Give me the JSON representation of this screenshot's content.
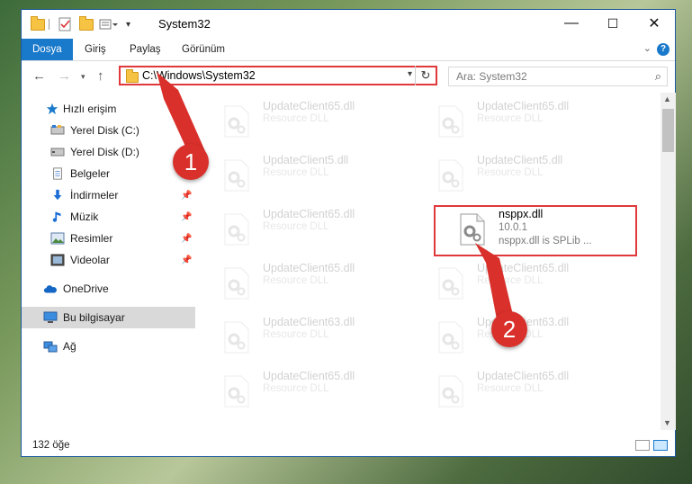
{
  "window": {
    "title": "System32",
    "controls": {
      "minimize": "—",
      "maximize": "☐",
      "close": "✕"
    }
  },
  "ribbon": {
    "tabs": [
      {
        "label": "Dosya",
        "active": true
      },
      {
        "label": "Giriş"
      },
      {
        "label": "Paylaş"
      },
      {
        "label": "Görünüm"
      }
    ],
    "help": "?"
  },
  "address": {
    "path": "C:\\Windows\\System32",
    "search_placeholder": "Ara: System32"
  },
  "sidebar": {
    "items": [
      {
        "label": "Hızlı erişim",
        "icon": "star-icon"
      },
      {
        "label": "Yerel Disk (C:)",
        "icon": "drive-icon",
        "pinned": true
      },
      {
        "label": "Yerel Disk (D:)",
        "icon": "drive-icon"
      },
      {
        "label": "Belgeler",
        "icon": "documents-icon",
        "pinned": true
      },
      {
        "label": "İndirmeler",
        "icon": "download-icon",
        "pinned": true
      },
      {
        "label": "Müzik",
        "icon": "music-icon",
        "pinned": true
      },
      {
        "label": "Resimler",
        "icon": "pictures-icon",
        "pinned": true
      },
      {
        "label": "Videolar",
        "icon": "videos-icon",
        "pinned": true
      },
      {
        "label": "OneDrive",
        "icon": "onedrive-icon"
      },
      {
        "label": "Bu bilgisayar",
        "icon": "computer-icon",
        "selected": true
      },
      {
        "label": "Ağ",
        "icon": "network-icon"
      }
    ]
  },
  "files": [
    {
      "name": "UpdateClient65.dll",
      "desc": "Resource DLL"
    },
    {
      "name": "UpdateClient65.dll",
      "desc": "Resource DLL"
    },
    {
      "name": "UpdateClient5.dll",
      "desc": "Resource DLL"
    },
    {
      "name": "UpdateClient5.dll",
      "desc": "Resource DLL"
    },
    {
      "name": "UpdateClient65.dll",
      "desc": "Resource DLL"
    },
    {
      "name": "nsppx.dll",
      "version": "10.0.1",
      "desc": "nsppx.dll is SPLib ..."
    },
    {
      "name": "UpdateClient65.dll",
      "desc": "Resource DLL"
    },
    {
      "name": "UpdateClient65.dll",
      "desc": "Resource DLL"
    },
    {
      "name": "UpdateClient63.dll",
      "desc": "Resource DLL"
    },
    {
      "name": "UpdateClient63.dll",
      "desc": "Resource DLL"
    },
    {
      "name": "UpdateClient65.dll",
      "desc": "Resource DLL"
    },
    {
      "name": "UpdateClient65.dll",
      "desc": "Resource DLL"
    }
  ],
  "status": {
    "item_count": "132 öğe"
  },
  "annotations": {
    "step1": "1",
    "step2": "2",
    "color": "#d9302b"
  }
}
